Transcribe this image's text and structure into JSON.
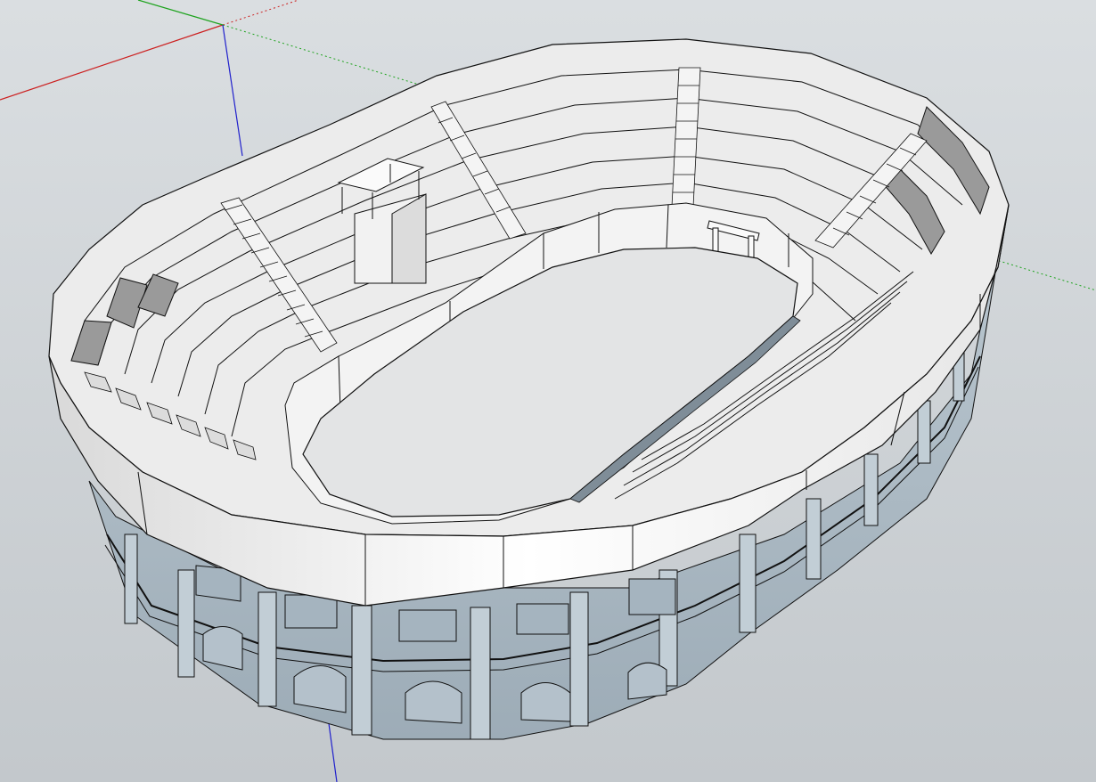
{
  "app": {
    "viewport_description": "",
    "background": {
      "top": "#d9dde0",
      "bottom": "#c2c7cb"
    }
  },
  "colors": {
    "axis_x": "#cc2020",
    "axis_y": "#1ea31e",
    "axis_z": "#2020cc",
    "face_light": "#ffffff",
    "face_arena": "#e3e4e5",
    "face_stone": "#aebcc6",
    "face_stone_dark": "#8f9fab",
    "edge": "#111111"
  },
  "scene": {
    "model": "amphitheatre",
    "axes": [
      "red-axis",
      "green-axis",
      "blue-axis"
    ]
  }
}
